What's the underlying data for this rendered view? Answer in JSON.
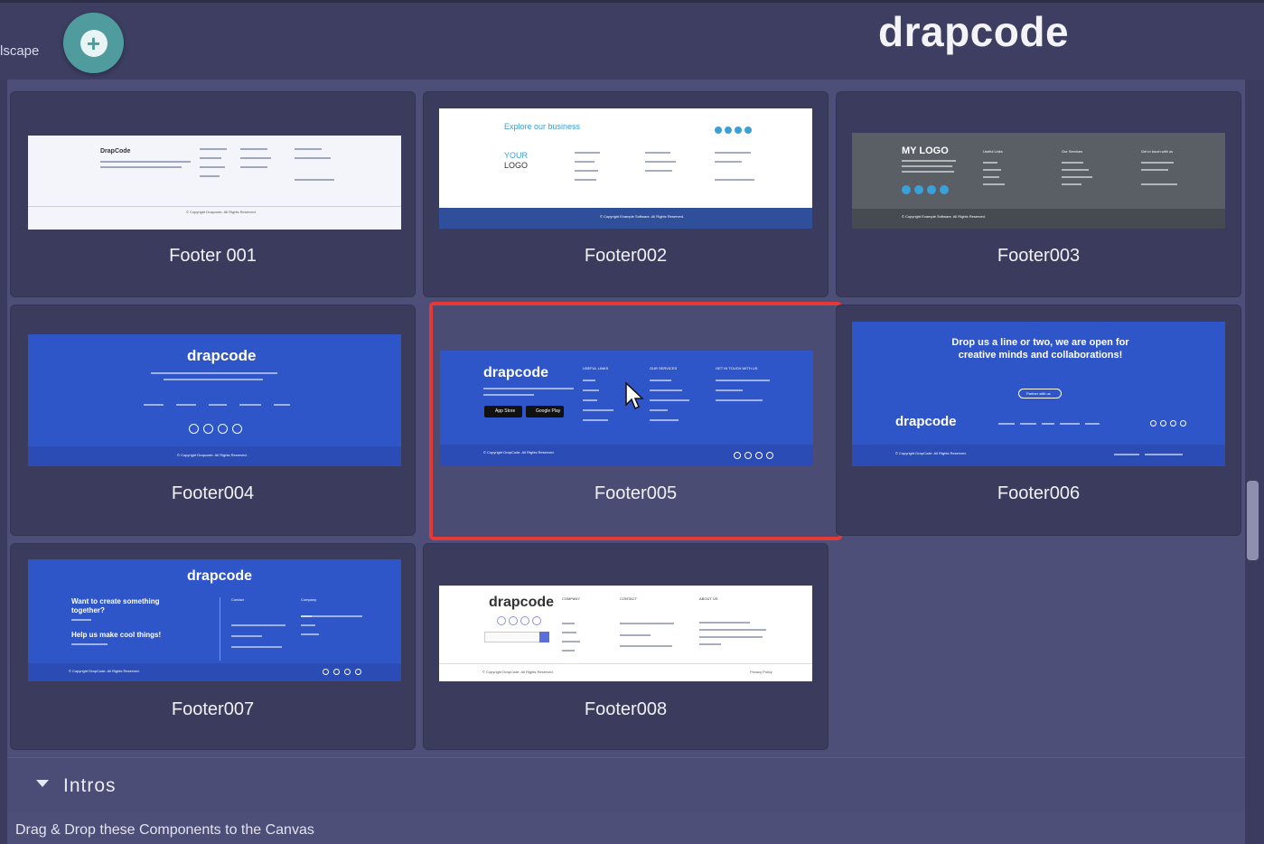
{
  "header": {
    "side_label": "lscape",
    "brand": "drapcode",
    "add_symbol": "+"
  },
  "components": [
    {
      "name": "Footer 001",
      "thumb_logo": "DrapCode",
      "thumb_copyright": "© Copyright Drapcode. All Rights Reserved."
    },
    {
      "name": "Footer002",
      "thumb_heading": "Explore our business",
      "thumb_logo_line1": "YOUR",
      "thumb_logo_line2": "LOGO",
      "thumb_copyright": "© Copyright Example Software. All Rights Reserved."
    },
    {
      "name": "Footer003",
      "thumb_logo": "MY LOGO",
      "thumb_col1": "Useful Links",
      "thumb_col2": "Our Services",
      "thumb_col3": "Get in touch with us",
      "thumb_copyright": "© Copyright Example Software. All Rights Reserved."
    },
    {
      "name": "Footer004",
      "thumb_logo": "drapcode",
      "thumb_copyright": "© Copyright Drapcode. All Rights Reserved."
    },
    {
      "name": "Footer005",
      "thumb_logo": "drapcode",
      "thumb_col1": "USEFUL LINKS",
      "thumb_col2": "OUR SERVICES",
      "thumb_col3": "GET IN TOUCH WITH US",
      "thumb_store1": "App Store",
      "thumb_store2": "Google Play",
      "thumb_copyright": "© Copyright DrapCode. All Rights Reserved."
    },
    {
      "name": "Footer006",
      "thumb_heading": "Drop us a line or two, we are open for creative minds and collaborations!",
      "thumb_button": "Partner with us",
      "thumb_logo": "drapcode",
      "thumb_copyright": "© Copyright DrapCode. All Rights Reserved."
    },
    {
      "name": "Footer007",
      "thumb_logo": "drapcode",
      "thumb_text1": "Want to create something together?",
      "thumb_text2": "Help us make cool things!",
      "thumb_col1": "Contact",
      "thumb_col2": "Company",
      "thumb_copyright": "© Copyright DrapCode. All Rights Reserved."
    },
    {
      "name": "Footer008",
      "thumb_logo": "drapcode",
      "thumb_col1": "COMPANY",
      "thumb_col2": "CONTACT",
      "thumb_col3": "ABOUT US",
      "thumb_copyright": "© Copyright DrapCode. All Rights Reserved.",
      "thumb_privacy": "Privacy Policy"
    }
  ],
  "selected_component": "Footer005",
  "section": {
    "label": "Intros",
    "hint": "Drag & Drop these Components to the Canvas"
  },
  "colors": {
    "accent": "#4f9b9e",
    "selection": "#e53935",
    "thumb_blue": "#2f56c8"
  }
}
